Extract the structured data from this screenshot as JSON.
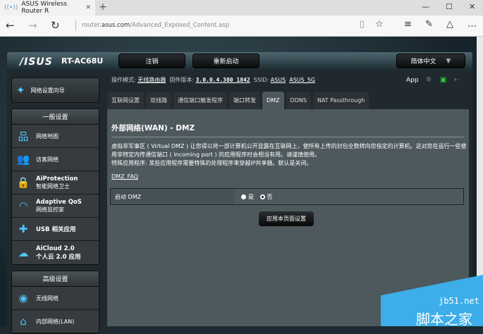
{
  "browser": {
    "tab_title": "ASUS Wireless Router R",
    "url_prefix": "router.",
    "url_domain": "asus.com",
    "url_path": "/Advanced_Exposed_Content.asp"
  },
  "header": {
    "logo": "/ISUS",
    "model": "RT-AC68U",
    "logout": "注销",
    "reboot": "重新启动",
    "language": "简体中文"
  },
  "status": {
    "mode_label": "操作模式:",
    "mode": "无线路由器",
    "fw_label": "固件版本:",
    "fw": "3.0.0.4.380_1842",
    "ssid_label": "SSID:",
    "ssid1": "ASUS",
    "ssid2": "ASUS_5G",
    "app": "App"
  },
  "sidebar": {
    "wizard": "网络设置向导",
    "general": "一般设置",
    "items": [
      {
        "t1": "网络地图",
        "t2": ""
      },
      {
        "t1": "访客网络",
        "t2": ""
      },
      {
        "t1": "AiProtection",
        "t2": "智能网络卫士"
      },
      {
        "t1": "Adaptive QoS",
        "t2": "网络监控家"
      },
      {
        "t1": "USB 相关应用",
        "t2": ""
      },
      {
        "t1": "AiCloud 2.0",
        "t2": "个人云 2.0 应用"
      }
    ],
    "advanced": "高级设置",
    "adv_items": [
      {
        "t1": "无线网络"
      },
      {
        "t1": "内部网络(LAN)"
      }
    ]
  },
  "tabs": [
    "互联网设置",
    "双线路",
    "通信端口触发程序",
    "端口转发",
    "DMZ",
    "DDNS",
    "NAT Passthrough"
  ],
  "main": {
    "title": "外部网络(WAN) - DMZ",
    "desc1": "虚拟非军事区 ( Virtual DMZ ) 让您得以将一部计算机公开显露在互联网上，使所有上传的封包全数转向您指定的计算机。这对您在运行一些使用非特定内传通信端口 ( incoming port ) 的应用程序时会相当有用。请谨慎使用。",
    "desc2": "特殊应用程序: 某些应用程序需要特殊的处理程序来穿越IP共享器。默认是关闭。",
    "faq": "DMZ_FAQ",
    "enable_label": "启动 DMZ",
    "yes": "是",
    "no": "否",
    "apply": "应用本页面设置"
  },
  "watermark": {
    "site": "jb51.net",
    "name": "脚本之家"
  }
}
